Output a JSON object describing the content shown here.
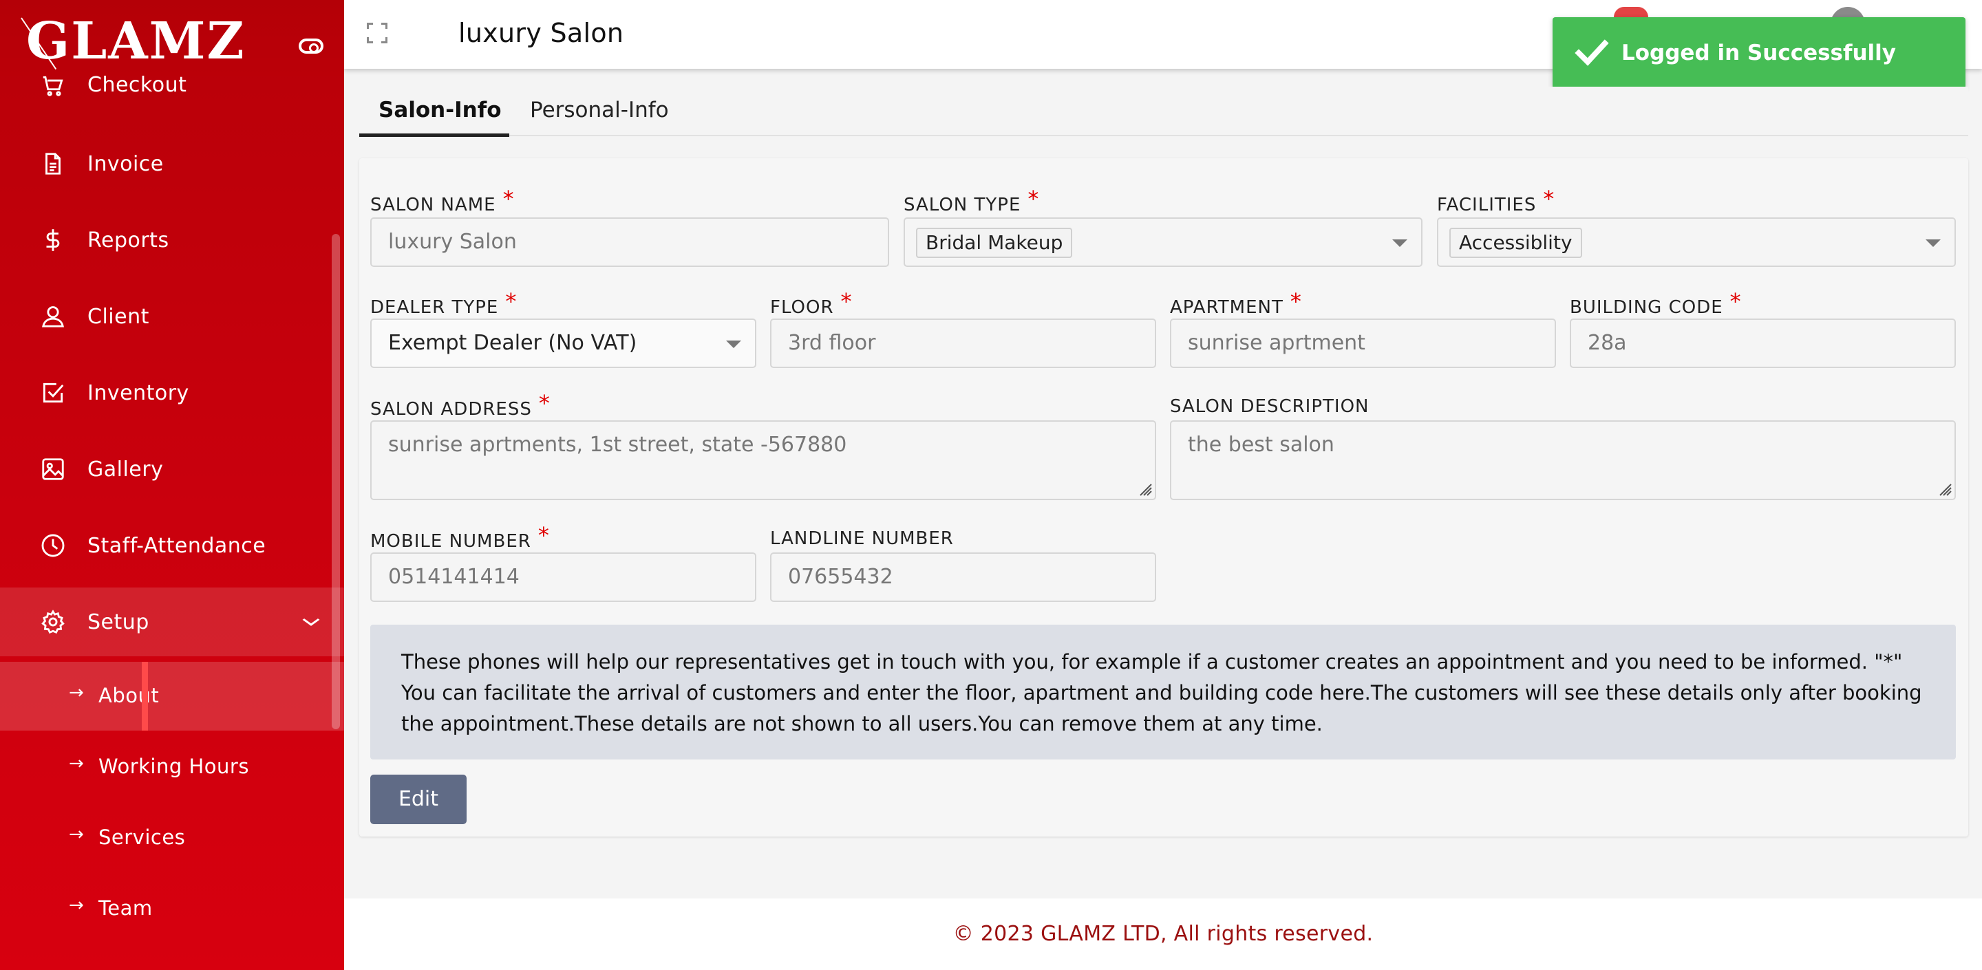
{
  "app": {
    "logo_text": "GLAMZ"
  },
  "sidebar": {
    "items": [
      {
        "label": "Checkout",
        "icon": "cart-icon"
      },
      {
        "label": "Invoice",
        "icon": "document-icon"
      },
      {
        "label": "Reports",
        "icon": "dollar-icon"
      },
      {
        "label": "Client",
        "icon": "user-icon"
      },
      {
        "label": "Inventory",
        "icon": "checkbox-icon"
      },
      {
        "label": "Gallery",
        "icon": "image-icon"
      },
      {
        "label": "Staff-Attendance",
        "icon": "clock-icon"
      },
      {
        "label": "Setup",
        "icon": "gear-icon",
        "expanded": true
      }
    ],
    "sub_items": [
      {
        "label": "About",
        "active": true
      },
      {
        "label": "Working Hours"
      },
      {
        "label": "Services"
      },
      {
        "label": "Team"
      }
    ]
  },
  "header": {
    "title": "luxury Salon"
  },
  "toast": {
    "message": "Logged in Successfully",
    "color": "#46bd55"
  },
  "tabs": [
    {
      "label": "Salon-Info",
      "active": true
    },
    {
      "label": "Personal-Info"
    }
  ],
  "form": {
    "salon_name": {
      "label": "SALON NAME",
      "value": "luxury Salon",
      "required": "*"
    },
    "salon_type": {
      "label": "SALON TYPE",
      "value": "Bridal Makeup",
      "required": "*"
    },
    "facilities": {
      "label": "FACILITIES",
      "value": "Accessiblity",
      "required": "*"
    },
    "dealer_type": {
      "label": "DEALER TYPE",
      "value": "Exempt Dealer (No VAT)",
      "required": "*"
    },
    "floor": {
      "label": "FLOOR",
      "value": "3rd floor",
      "required": "*"
    },
    "apartment": {
      "label": "APARTMENT",
      "value": "sunrise aprtment",
      "required": "*"
    },
    "building_code": {
      "label": "BUILDING CODE",
      "value": "28a",
      "required": "*"
    },
    "salon_address": {
      "label": "SALON ADDRESS",
      "value": "sunrise aprtments, 1st street, state -567880",
      "required": "*"
    },
    "salon_description": {
      "label": "SALON DESCRIPTION",
      "value": "the best salon"
    },
    "mobile_number": {
      "label": "MOBILE NUMBER",
      "value": "0514141414",
      "required": "*"
    },
    "landline_number": {
      "label": "LANDLINE NUMBER",
      "value": "07655432"
    },
    "info_text": "These phones will help our representatives get in touch with you, for example if a customer creates an appointment and you need to be informed. \"*\" You can facilitate the arrival of customers and enter the floor, apartment and building code here.The customers will see these details only after booking the appointment.These details are not shown to all users.You can remove them at any time.",
    "edit_label": "Edit"
  },
  "footer": {
    "text": "© 2023 GLAMZ LTD, All rights reserved."
  },
  "colors": {
    "sidebar": "#c4000c",
    "accent_required": "#e00000",
    "edit_button": "#606b86",
    "footer_text": "#9b1010"
  }
}
